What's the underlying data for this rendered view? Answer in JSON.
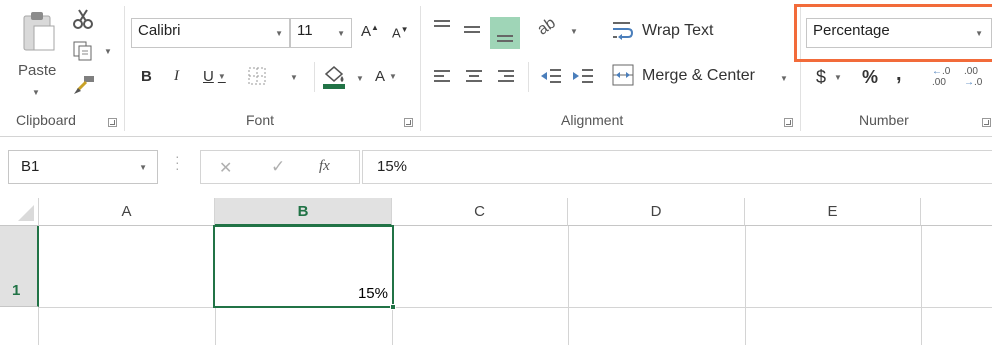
{
  "clipboard": {
    "paste_label": "Paste",
    "group_label": "Clipboard"
  },
  "font": {
    "name": "Calibri",
    "size": "11",
    "grow_label": "A",
    "shrink_label": "A",
    "bold_label": "B",
    "italic_label": "I",
    "underline_label": "U",
    "font_color_label": "A",
    "fill_color": "#217346",
    "group_label": "Font"
  },
  "alignment": {
    "wrap_text_label": "Wrap Text",
    "merge_center_label": "Merge & Center",
    "group_label": "Alignment"
  },
  "number": {
    "format_value": "Percentage",
    "currency_label": "$",
    "percent_label": "%",
    "comma_label": ",",
    "increase_decimal_top": ".0",
    "increase_decimal_bottom": ".00",
    "decrease_decimal_top": ".00",
    "decrease_decimal_bottom": ".0",
    "group_label": "Number",
    "highlight_color": "#f26b3a"
  },
  "formula_bar": {
    "name_box": "B1",
    "cancel_icon": "✕",
    "enter_icon": "✓",
    "fx_label": "fx",
    "formula_value": "15%"
  },
  "grid": {
    "columns": [
      "A",
      "B",
      "C",
      "D",
      "E"
    ],
    "rows": [
      "1"
    ],
    "selected_cell_value": "15%",
    "accent_color": "#217346"
  }
}
